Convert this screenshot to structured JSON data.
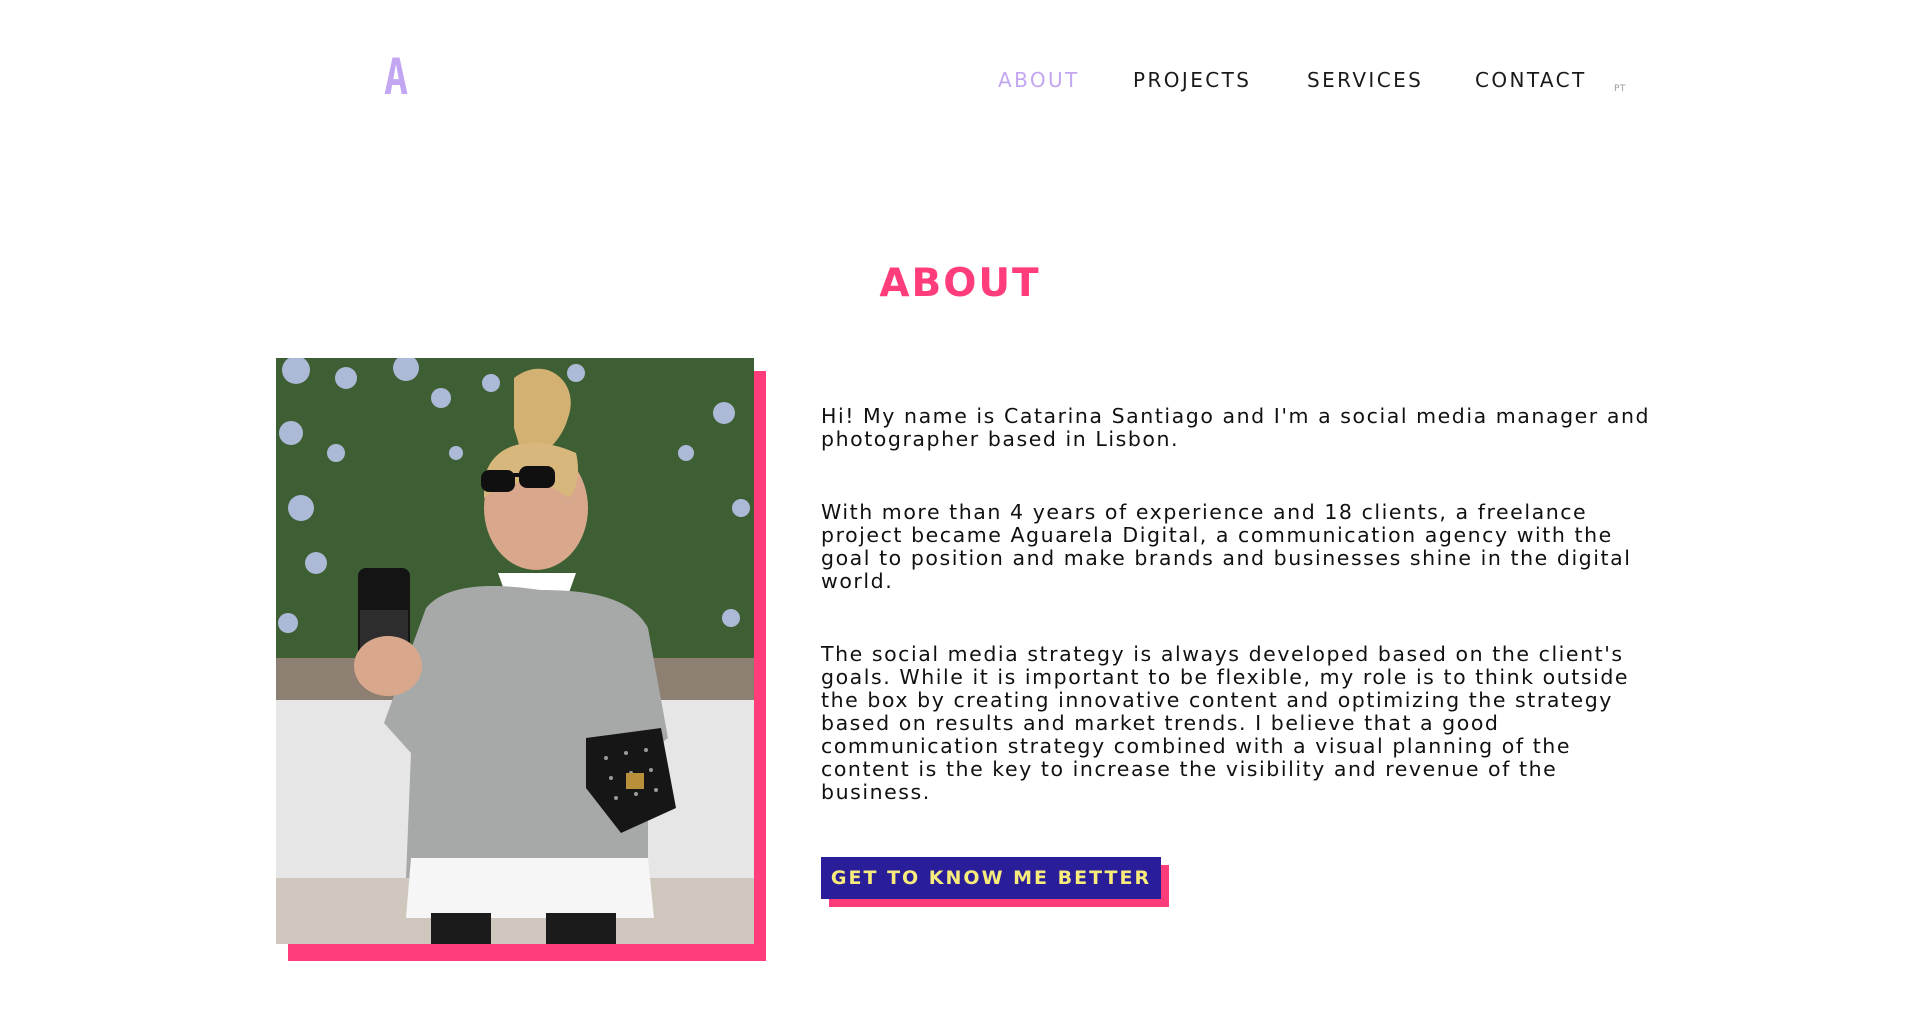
{
  "header": {
    "logo": "A",
    "nav": {
      "about": "ABOUT",
      "projects": "PROJECTS",
      "services": "SERVICES",
      "contact": "CONTACT",
      "lang": "PT"
    }
  },
  "main": {
    "title": "ABOUT",
    "paragraphs": [
      "Hi! My name is Catarina Santiago and I'm a social media manager and photographer based in Lisbon.",
      "With more than 4 years of experience and 18 clients, a freelance project became Aguarela Digital, a communication agency with the goal to position and make brands and businesses shine in the digital world.",
      "The social media strategy is always developed based on the client's goals. While it is important to be flexible, my role is to think outside the box by creating innovative content and optimizing the strategy based on results and market trends. I believe that a good communication strategy combined with a visual planning of the content is the key to increase the visibility and revenue of the business."
    ],
    "cta_label": "GET TO KNOW ME BETTER"
  },
  "colors": {
    "accent_pink": "#ff3d7a",
    "accent_lilac": "#c3a6f2",
    "button_bg": "#2a1d9a",
    "button_text": "#f7eb7c"
  }
}
